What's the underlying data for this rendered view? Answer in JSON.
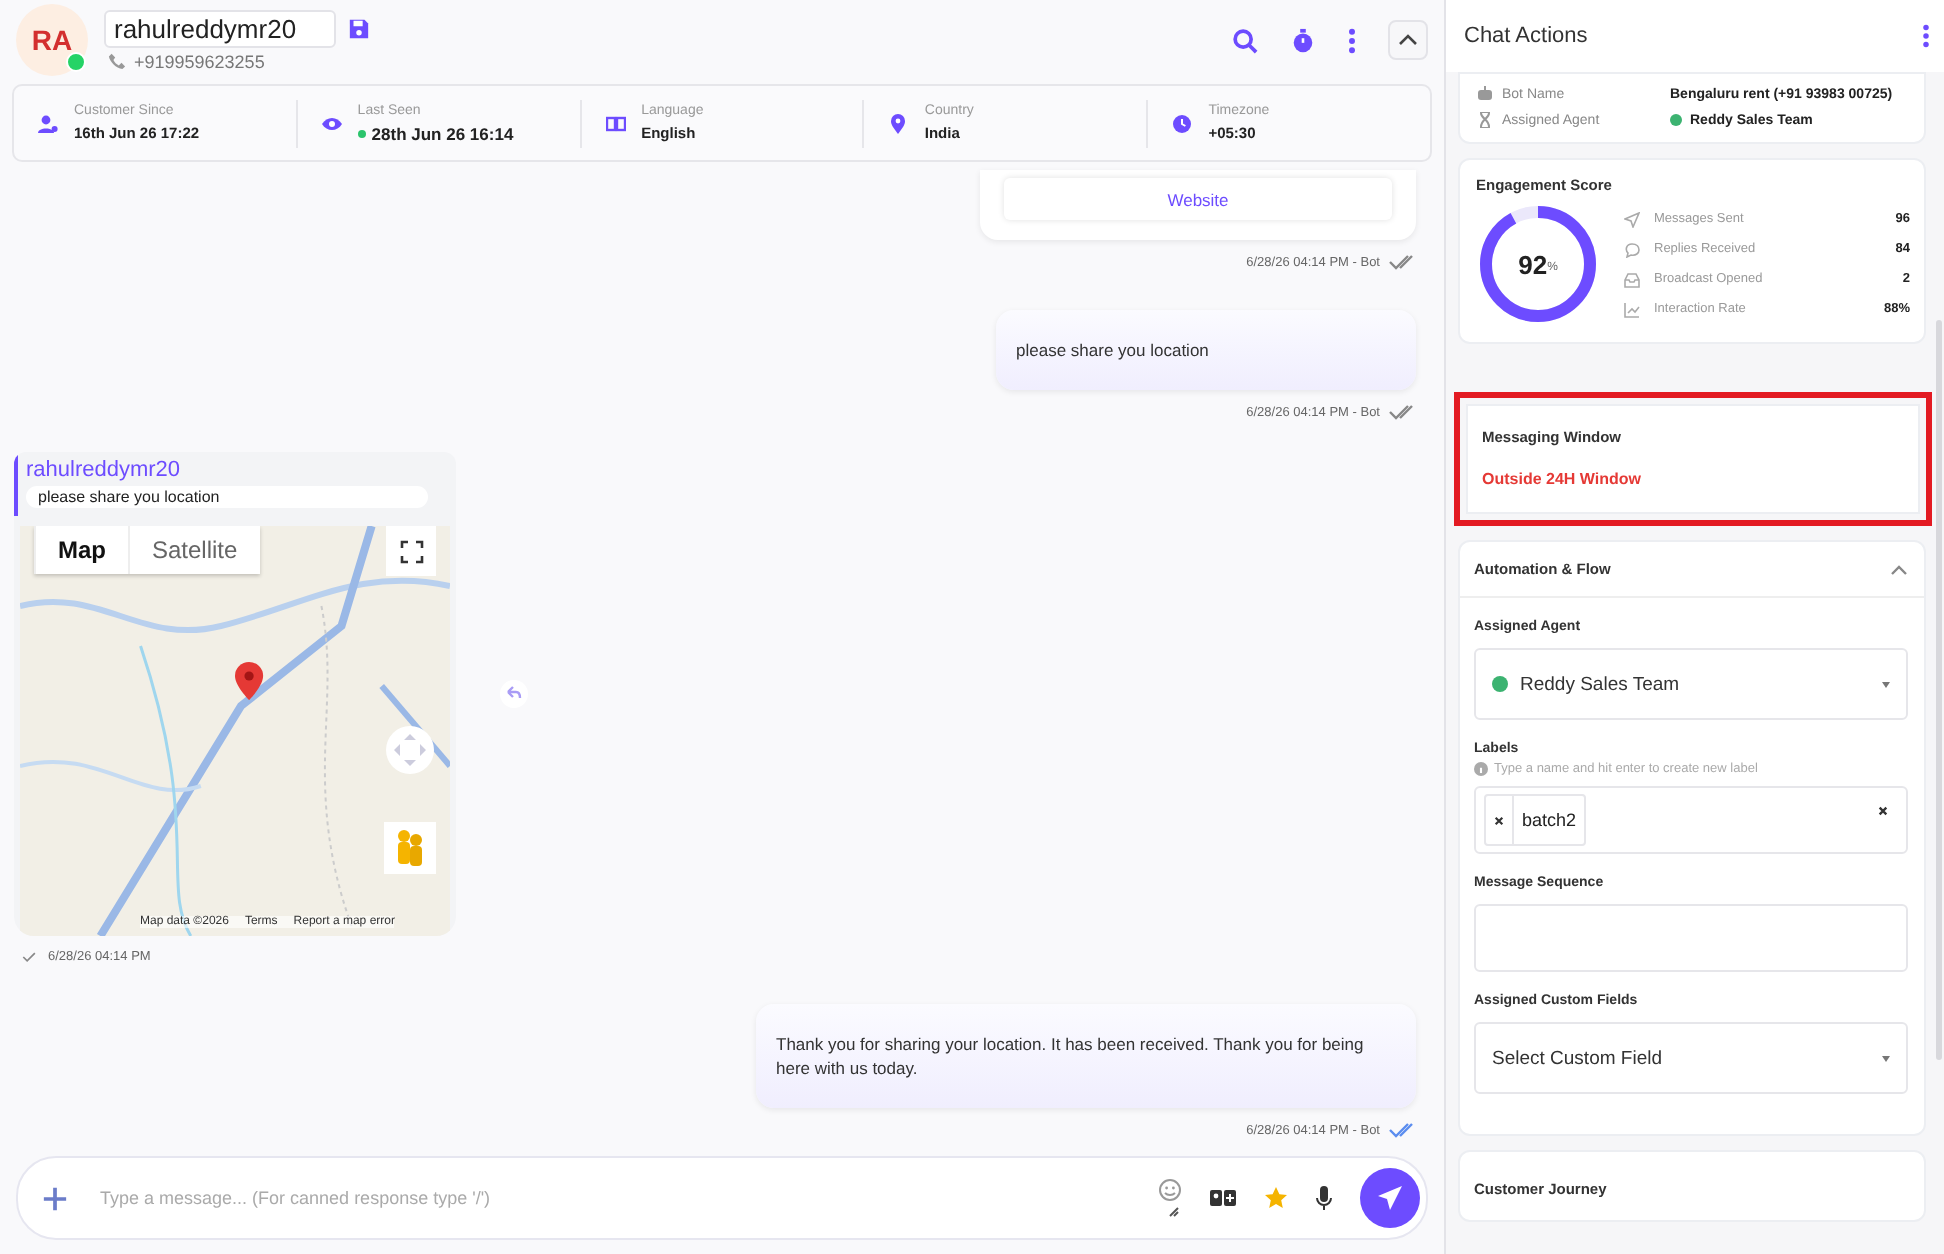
{
  "contact": {
    "initials": "RA",
    "name": "rahulreddymr20",
    "phone": "+919959623255",
    "online": true
  },
  "info": [
    {
      "kind": "customer",
      "label": "Customer Since",
      "value": "16th Jun 26 17:22",
      "dot": false
    },
    {
      "kind": "seen",
      "label": "Last Seen",
      "value": "28th Jun 26 16:14",
      "dot": true
    },
    {
      "kind": "language",
      "label": "Language",
      "value": "English",
      "dot": false
    },
    {
      "kind": "country",
      "label": "Country",
      "value": "India",
      "dot": false
    },
    {
      "kind": "timezone",
      "label": "Timezone",
      "value": "+05:30",
      "dot": false
    }
  ],
  "messages": [
    {
      "kind": "button_card",
      "button": "Website",
      "time": "6/28/26 04:14 PM - Bot",
      "double_tick": true,
      "read": false
    },
    {
      "kind": "outgoing",
      "text": "please share you location",
      "time": "6/28/26 04:14 PM - Bot",
      "double_tick": true,
      "read": false
    },
    {
      "kind": "location",
      "author": "rahulreddymr20",
      "quote": "please share you location",
      "map_types": [
        {
          "label": "Map",
          "selected": true
        },
        {
          "label": "Satellite",
          "selected": false
        }
      ],
      "attribution": [
        "Map data ©2026",
        "Terms",
        "Report a map error"
      ],
      "time": "6/28/26 04:14 PM",
      "double_tick": false,
      "read": false
    },
    {
      "kind": "outgoing",
      "text": "Thank you for sharing your location. It has been received. Thank you for being here with us today.",
      "time": "6/28/26 04:14 PM - Bot",
      "double_tick": true,
      "read": true
    }
  ],
  "composer": {
    "placeholder": "Type a message... (For canned response type '/')"
  },
  "panel": {
    "title": "Chat Actions",
    "details": [
      {
        "kind": "bot",
        "label": "Bot Name",
        "value": "Bengaluru rent (+91 93983 00725)"
      },
      {
        "kind": "agent",
        "label": "Assigned Agent",
        "value": "Reddy Sales Team"
      }
    ],
    "engagement": {
      "title": "Engagement Score",
      "score": "92",
      "unit": "%",
      "level": 0.92,
      "stats": [
        {
          "kind": "sent",
          "label": "Messages Sent",
          "value": "96"
        },
        {
          "kind": "replies",
          "label": "Replies Received",
          "value": "84"
        },
        {
          "kind": "broadcast",
          "label": "Broadcast Opened",
          "value": "2"
        },
        {
          "kind": "rate",
          "label": "Interaction Rate",
          "value": "88%"
        }
      ]
    },
    "window": {
      "title": "Messaging Window",
      "status": "Outside 24H Window",
      "highlighted": true
    },
    "automation": {
      "title": "Automation & Flow",
      "expanded": true,
      "agent_label": "Assigned Agent",
      "agent": "Reddy Sales Team",
      "labels_label": "Labels",
      "labels_hint": "Type a name and hit enter to create new label",
      "labels": [
        "batch2"
      ],
      "sequence_label": "Message Sequence",
      "fields_label": "Assigned Custom Fields",
      "fields_placeholder": "Select Custom Field"
    },
    "next_section": "Customer Journey"
  }
}
